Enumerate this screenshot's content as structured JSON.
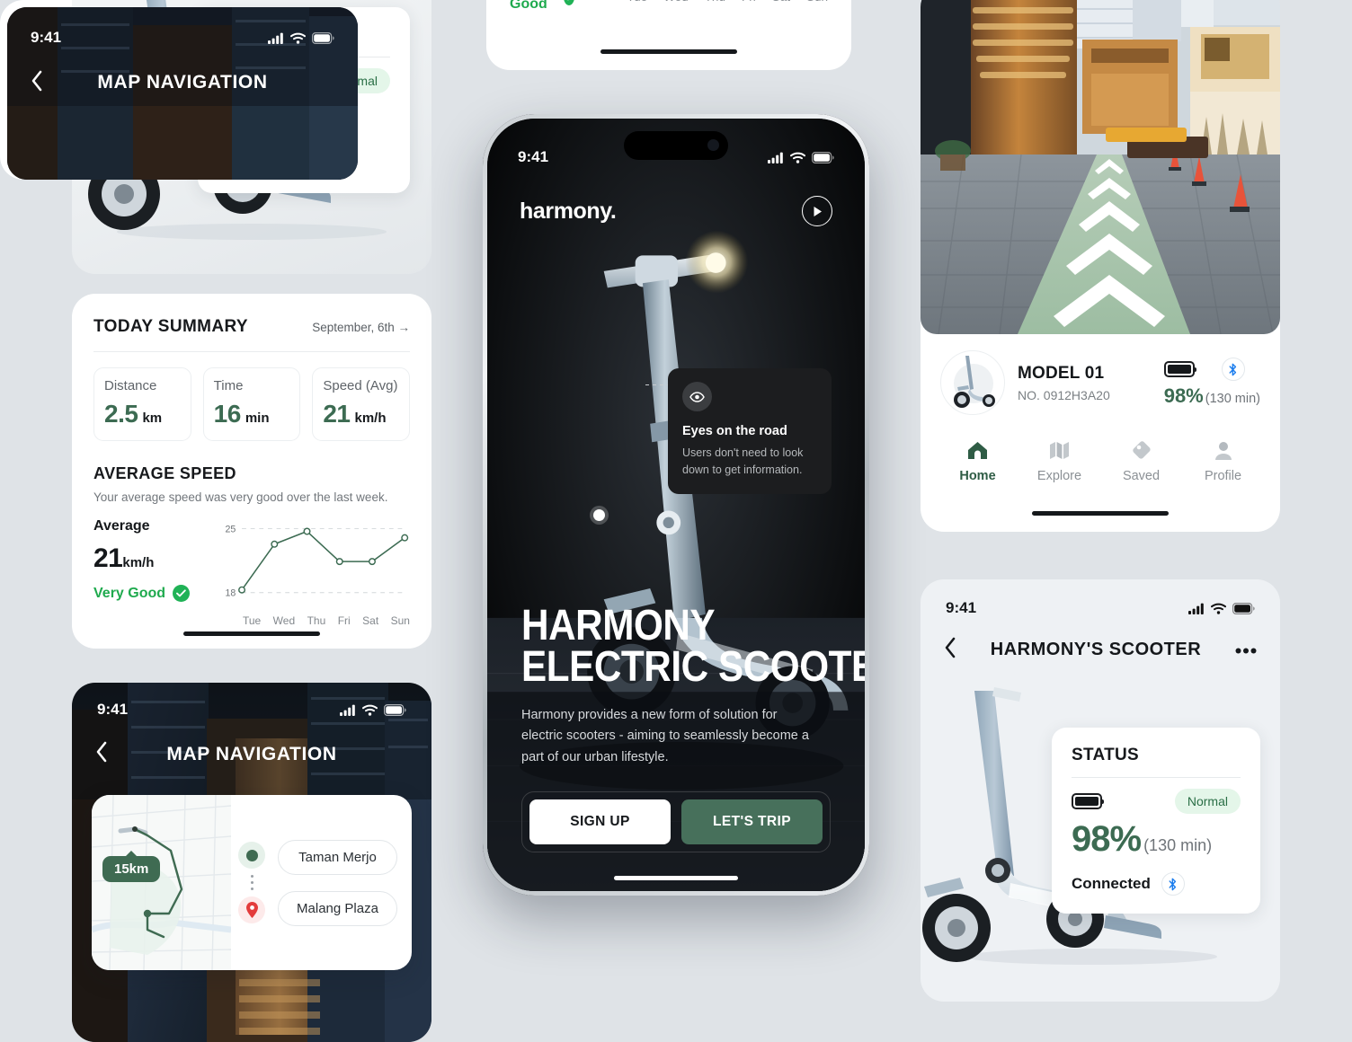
{
  "meta": {
    "accent_green": "#3c6b52",
    "button_green": "#47705b",
    "bg": "#dfe3e7",
    "success_green": "#20b256"
  },
  "status_card": {
    "title": "STATUS",
    "badge": "Normal",
    "percent": "98%",
    "duration": "(130 min)",
    "connected_label": "Connected",
    "battery_icon": "battery-icon",
    "bluetooth_icon": "bluetooth-icon"
  },
  "summary": {
    "title": "TODAY SUMMARY",
    "date": "September, 6th →",
    "stats": [
      {
        "label": "Distance",
        "value": "2.5",
        "unit": "km"
      },
      {
        "label": "Time",
        "value": "16",
        "unit": "min"
      },
      {
        "label": "Speed (Avg)",
        "value": "21",
        "unit": "km/h"
      }
    ],
    "avg_title": "AVERAGE SPEED",
    "avg_desc": "Your average speed was very good over the last week.",
    "avg_key": "Average",
    "avg_value": "21",
    "avg_unit": "km/h",
    "rating": "Very Good"
  },
  "chart_data": {
    "type": "line",
    "title": "AVERAGE SPEED",
    "categories": [
      "Tue",
      "Wed",
      "Thu",
      "Fri",
      "Sat",
      "Sun"
    ],
    "values": [
      18.3,
      23.3,
      24.7,
      21.4,
      21.4,
      24.0
    ],
    "series": [
      {
        "name": "Average speed",
        "values": [
          18.3,
          23.3,
          24.7,
          21.4,
          21.4,
          24.0
        ]
      }
    ],
    "xlabel": "",
    "ylabel": "",
    "ylim": [
      18,
      25
    ],
    "yticks": [
      18,
      25
    ],
    "ytick_labels": [
      "18",
      "25"
    ],
    "grid": true,
    "legend": "none",
    "line_color": "#3c6b52",
    "marker": "open-circle",
    "unit": "km/h"
  },
  "map_nav": {
    "time": "9:41",
    "title": "MAP NAVIGATION",
    "distance_badge": "15km",
    "start": "Taman Merjo",
    "end": "Malang Plaza",
    "back_icon": "chevron-left-icon"
  },
  "phone": {
    "time": "9:41",
    "brand": "harmony.",
    "play_icon": "play-icon",
    "tooltip": {
      "icon": "eye-icon",
      "title": "Eyes on the road",
      "desc": "Users don't need to look down to get information."
    },
    "headline_line1": "HARMONY",
    "headline_line2": "ELECTRIC SCOOTER",
    "paragraph": "Harmony provides a new form of solution for electric scooters - aiming to seamlessly become a part of our urban lifestyle.",
    "btn_signup": "SIGN UP",
    "btn_trip": "LET'S TRIP"
  },
  "model_card": {
    "name": "MODEL 01",
    "serial": "NO. 0912H3A20",
    "percent": "98%",
    "duration": "(130 min)",
    "tabs": [
      {
        "label": "Home",
        "icon": "home-icon",
        "active": true
      },
      {
        "label": "Explore",
        "icon": "map-icon",
        "active": false
      },
      {
        "label": "Saved",
        "icon": "tag-icon",
        "active": false
      },
      {
        "label": "Profile",
        "icon": "person-icon",
        "active": false
      }
    ]
  },
  "harmony_scooter": {
    "time": "9:41",
    "title": "HARMONY'S SCOOTER",
    "back_icon": "chevron-left-icon",
    "more_icon": "more-horizontal-icon",
    "status": {
      "title": "STATUS",
      "badge": "Normal",
      "percent": "98%",
      "duration": "(130 min)",
      "connected_label": "Connected"
    }
  },
  "top_partial": {
    "rating": "Very Good",
    "days": [
      "Tue",
      "Wed",
      "Thu",
      "Fri",
      "Sat",
      "Sun"
    ]
  },
  "bottom_partial": {
    "time": "9:41",
    "title": "MAP NAVIGATION"
  }
}
